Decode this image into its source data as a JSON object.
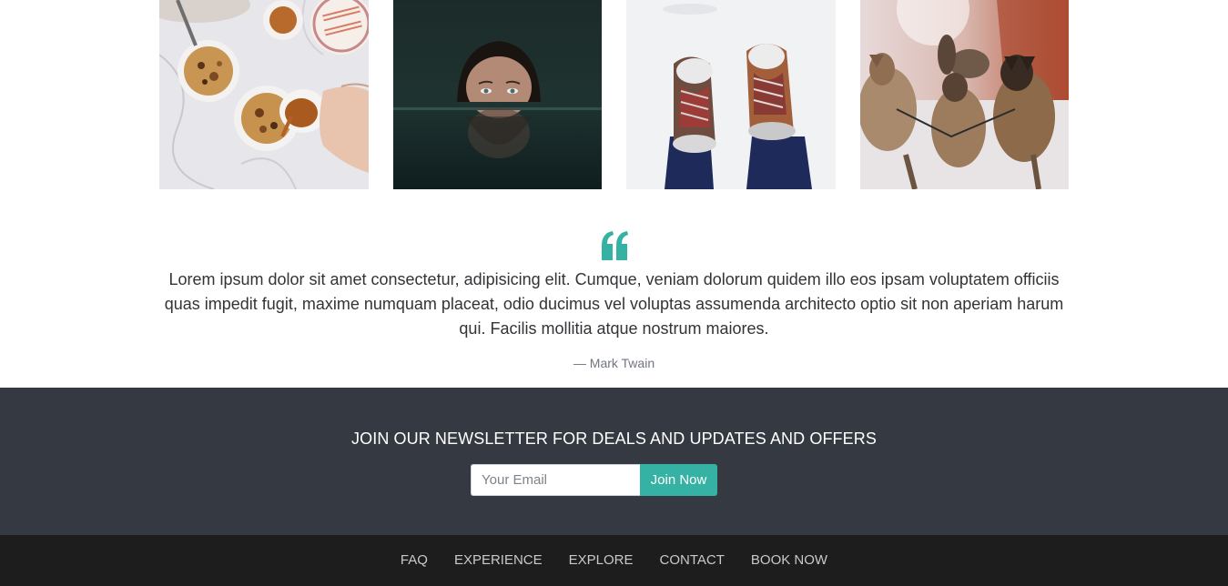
{
  "gallery": {
    "photos": [
      {
        "icon": "oatmeal-bowls-photo"
      },
      {
        "icon": "woman-in-water-photo"
      },
      {
        "icon": "snow-boots-photo"
      },
      {
        "icon": "sled-dogs-photo"
      }
    ]
  },
  "testimonial": {
    "icon": "quote-icon",
    "accent_color": "#35b2a4",
    "text": "Lorem ipsum dolor sit amet consectetur, adipisicing elit. Cumque, veniam dolorum quidem illo eos ipsam voluptatem officiis quas impedit fugit, maxime numquam placeat, odio ducimus vel voluptas assumenda architecto optio sit non aperiam harum qui. Facilis mollitia atque nostrum maiores.",
    "author": "— Mark Twain"
  },
  "newsletter": {
    "title": "JOIN OUR NEWSLETTER FOR DEALS AND UPDATES AND OFFERS",
    "email_placeholder": "Your Email",
    "email_value": "",
    "button_label": "Join Now",
    "background_color": "#353942",
    "button_color": "#35b2a4"
  },
  "footer": {
    "background_color": "#1d1d1d",
    "links": [
      {
        "label": "FAQ"
      },
      {
        "label": "EXPERIENCE"
      },
      {
        "label": "EXPLORE"
      },
      {
        "label": "CONTACT"
      },
      {
        "label": "BOOK NOW"
      }
    ]
  }
}
